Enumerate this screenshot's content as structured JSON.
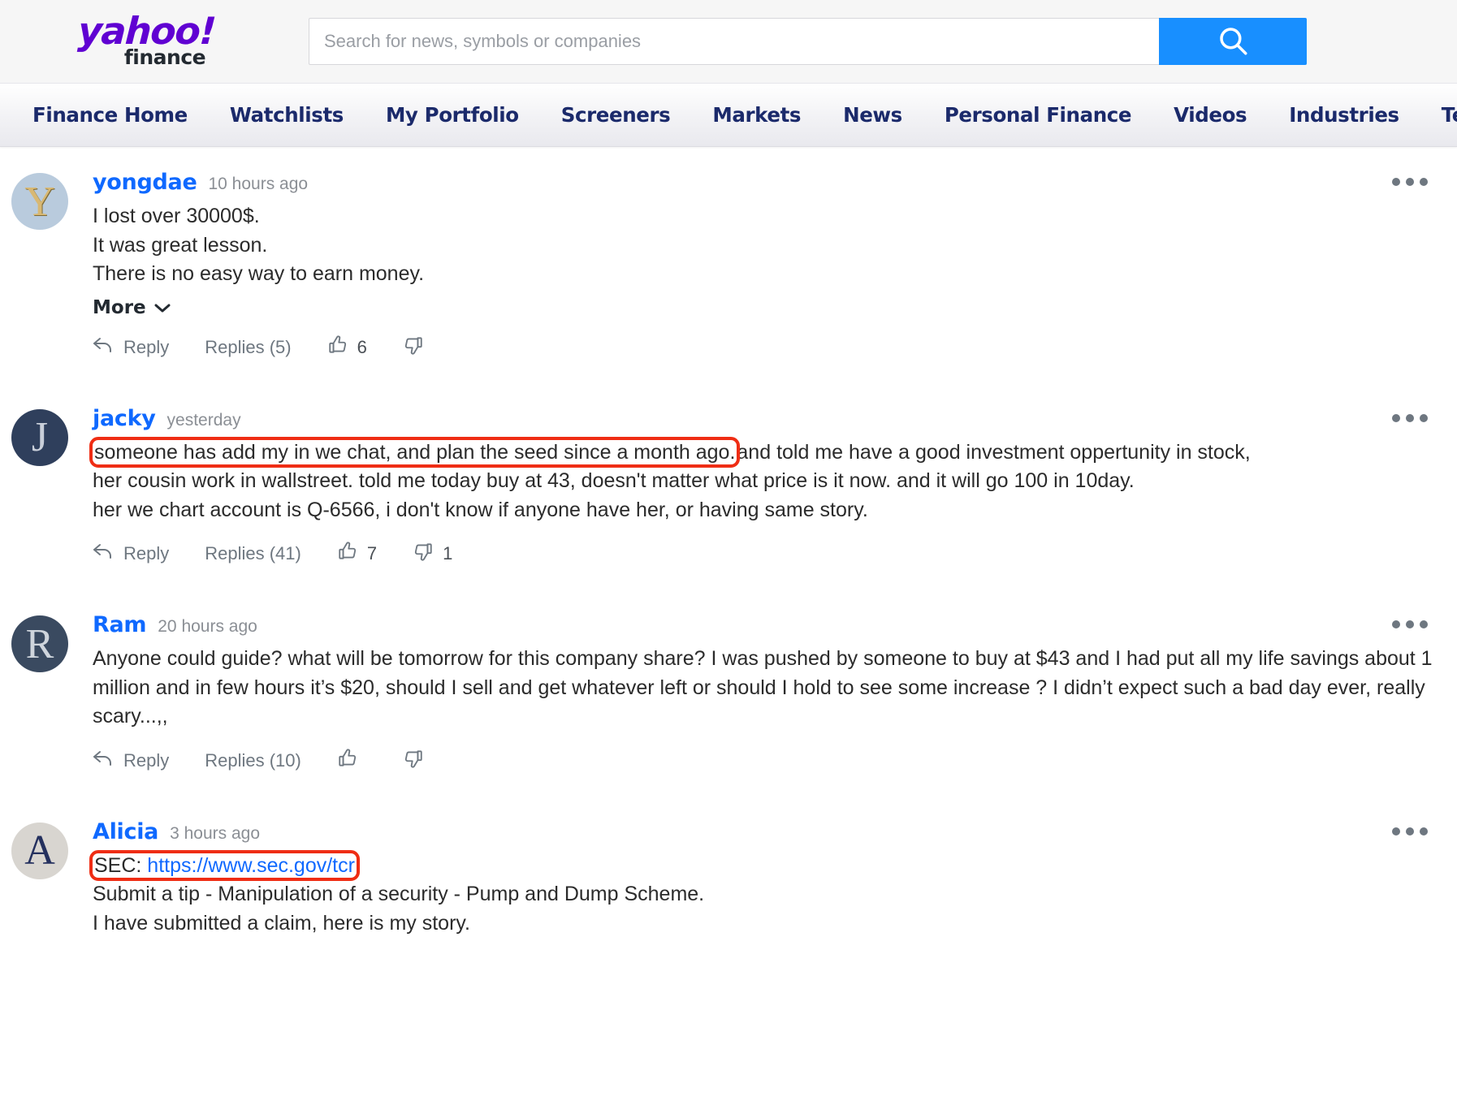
{
  "header": {
    "logo_primary": "yahoo",
    "logo_bang": "!",
    "logo_secondary": "finance",
    "search": {
      "placeholder": "Search for news, symbols or companies",
      "value": "",
      "button_icon": "search-icon"
    },
    "accent_color": "#188fff",
    "brand_color": "#6001d2"
  },
  "nav": {
    "items": [
      {
        "label": "Finance Home"
      },
      {
        "label": "Watchlists"
      },
      {
        "label": "My Portfolio"
      },
      {
        "label": "Screeners"
      },
      {
        "label": "Markets"
      },
      {
        "label": "News"
      },
      {
        "label": "Personal Finance"
      },
      {
        "label": "Videos"
      },
      {
        "label": "Industries"
      },
      {
        "label": "Tech"
      }
    ],
    "text_color": "#1b2a6b"
  },
  "highlight_color": "#ef2d14",
  "comments": [
    {
      "avatar_letter": "Y",
      "author": "yongdae",
      "time": "10 hours ago",
      "lines": [
        "I lost over 30000$.",
        "It was great lesson.",
        "There is no easy way to earn money."
      ],
      "more_label": "More",
      "actions": {
        "reply": "Reply",
        "replies": "Replies (5)",
        "up_count": "6",
        "down_count": ""
      },
      "menu_icon": "overflow-menu-icon"
    },
    {
      "avatar_letter": "J",
      "author": "jacky",
      "time": "yesterday",
      "highlighted_text": "someone has add my in we chat, and plan the seed since a month ago.",
      "rest_line1": "and told me have a good investment oppertunity in stock,",
      "line2": "her cousin work in wallstreet. told me today buy at 43, doesn't matter what price is it now. and it will go 100 in 10day.",
      "line3": "her we chart account is Q-6566, i don't know if anyone have her, or having same story.",
      "actions": {
        "reply": "Reply",
        "replies": "Replies (41)",
        "up_count": "7",
        "down_count": "1"
      },
      "menu_icon": "overflow-menu-icon"
    },
    {
      "avatar_letter": "R",
      "author": "Ram",
      "time": "20 hours ago",
      "paragraph": "Anyone could guide? what will be tomorrow for this company share? I was pushed by someone to buy at $43 and I had put all my life savings about 1 million and in few hours it’s $20, should I sell and get whatever left or should I hold to see some increase ? I didn’t expect such a bad day ever, really scary...,,",
      "actions": {
        "reply": "Reply",
        "replies": "Replies (10)",
        "up_count": "",
        "down_count": ""
      },
      "menu_icon": "overflow-menu-icon"
    },
    {
      "avatar_letter": "A",
      "author": "Alicia",
      "time": "3 hours ago",
      "sec_prefix": "SEC: ",
      "sec_link": "https://www.sec.gov/tcr",
      "line2": "Submit a tip - Manipulation of a security - Pump and Dump Scheme.",
      "line3": "I have submitted a claim, here is my story.",
      "menu_icon": "overflow-menu-icon"
    }
  ]
}
